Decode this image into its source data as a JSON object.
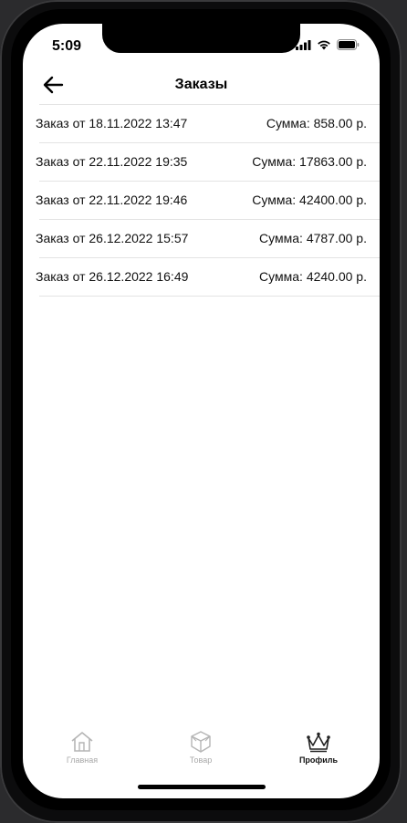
{
  "status_bar": {
    "time": "5:09",
    "icons": [
      "cellular-signal-icon",
      "wifi-icon",
      "battery-icon"
    ]
  },
  "header": {
    "back_icon": "arrow-left-icon",
    "title": "Заказы"
  },
  "orders": [
    {
      "label": "Заказ от 18.11.2022 13:47",
      "sum": "Сумма: 858.00 р."
    },
    {
      "label": "Заказ от 22.11.2022 19:35",
      "sum": "Сумма: 17863.00 р."
    },
    {
      "label": "Заказ от 22.11.2022 19:46",
      "sum": "Сумма: 42400.00 р."
    },
    {
      "label": "Заказ от 26.12.2022 15:57",
      "sum": "Сумма: 4787.00 р."
    },
    {
      "label": "Заказ от 26.12.2022 16:49",
      "sum": "Сумма: 4240.00 р."
    }
  ],
  "tab_bar": {
    "tabs": [
      {
        "label": "Главная",
        "icon": "home-icon",
        "active": false
      },
      {
        "label": "Товар",
        "icon": "box-icon",
        "active": false
      },
      {
        "label": "Профиль",
        "icon": "crown-icon",
        "active": true
      }
    ]
  },
  "colors": {
    "active_tab": "#111111",
    "inactive_tab": "#a9a9a9",
    "divider": "#e3e3e3"
  }
}
